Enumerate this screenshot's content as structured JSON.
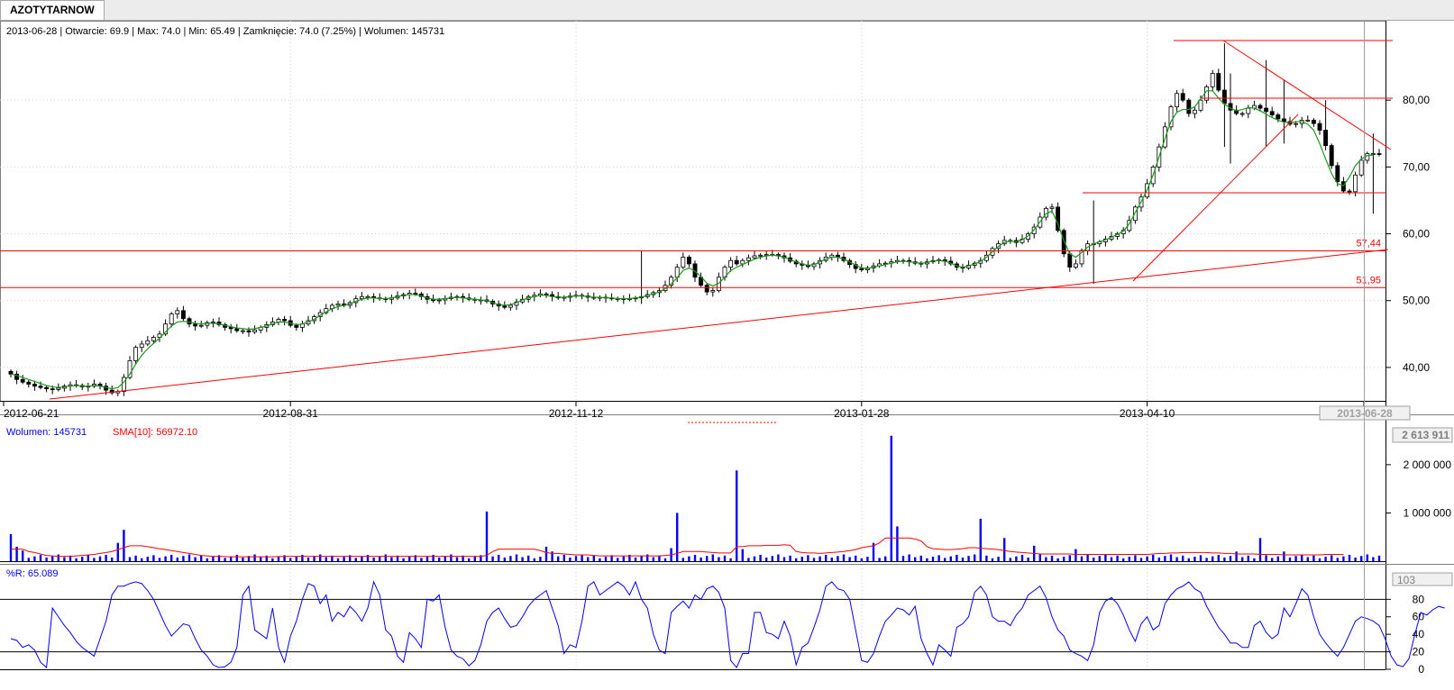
{
  "tab": {
    "title": "AZOTYTARNOW"
  },
  "price_info": "2013-06-28 | Otwarcie: 69.9 | Max: 74.0 | Min: 65.49 | Zamknięcie: 74.0 (7.25%)  | Wolumen: 145731",
  "volume_info": {
    "label": "Wolumen: 145731",
    "sma_label": "SMA[10]: 56972.10"
  },
  "wr_info": "%R: 65.089",
  "colors": {
    "up": "#ffffff",
    "down": "#000000",
    "sma": "#1a9a1a",
    "lines": "#ff0000",
    "volume": "#0000ff",
    "wr": "#0000ff"
  },
  "chart_data": [
    {
      "type": "candlestick",
      "x_labels": [
        "2012-06-21",
        "2012-08-31",
        "2012-11-12",
        "2013-01-28",
        "2013-04-10",
        "2013-06-28"
      ],
      "y_ticks": [
        "40,00",
        "50,00",
        "60,00",
        "70,00",
        "80,00"
      ],
      "ylim": [
        35,
        90
      ],
      "h_levels": [
        {
          "value": 57.44,
          "label": "57,44"
        },
        {
          "value": 51.95,
          "label": "51,95"
        }
      ],
      "close": [
        39,
        38.2,
        37.8,
        37.5,
        37.2,
        37,
        36.8,
        36.7,
        36.9,
        37.2,
        37.4,
        37.3,
        37.1,
        37.2,
        37.5,
        37.2,
        36.6,
        36.2,
        36.4,
        38.5,
        41,
        43,
        43.5,
        44,
        44.5,
        45,
        46.5,
        48,
        48.5,
        47.3,
        46.5,
        46.2,
        46.3,
        46.7,
        46.8,
        46.4,
        46,
        45.8,
        45.5,
        45.5,
        45.3,
        45.6,
        46,
        46.4,
        46.8,
        47.2,
        47,
        46.3,
        46,
        46.5,
        47,
        47.6,
        48.2,
        48.8,
        49.3,
        49.5,
        49.3,
        49.7,
        50.3,
        50.6,
        50.6,
        50.4,
        50.3,
        50.2,
        50.4,
        50.7,
        50.9,
        51.1,
        51,
        50.6,
        50.2,
        50,
        50.1,
        50.3,
        50.5,
        50.6,
        50.4,
        50.2,
        50.1,
        50.1,
        49.9,
        49.5,
        49.2,
        49,
        49.3,
        49.8,
        50.2,
        50.6,
        50.8,
        51,
        50.9,
        50.6,
        50.4,
        50.5,
        50.7,
        50.8,
        50.7,
        50.5,
        50.4,
        50.5,
        50.4,
        50.3,
        50.3,
        50.2,
        50.3,
        50.4,
        50.6,
        50.9,
        51.2,
        51.5,
        52.3,
        53.5,
        55,
        56.5,
        55.5,
        53.5,
        52.3,
        51.3,
        51.5,
        53.5,
        55,
        56,
        55.5,
        56,
        56.4,
        56.7,
        56.8,
        56.9,
        56.9,
        56.7,
        56.4,
        55.9,
        55.5,
        55.3,
        55.1,
        55.5,
        56,
        56.5,
        56.8,
        56.5,
        56,
        55.4,
        54.8,
        54.6,
        54.9,
        55.2,
        55.5,
        55.6,
        55.8,
        56,
        56,
        55.8,
        55.6,
        55.5,
        55.8,
        56,
        56.1,
        55.9,
        55.5,
        55,
        54.9,
        55.3,
        55.6,
        56,
        56.8,
        57.8,
        58.5,
        59,
        59,
        58.7,
        59.2,
        60,
        61,
        62.5,
        63.8,
        64,
        60.5,
        57,
        55,
        55.5,
        57.5,
        58.5,
        58.5,
        58.8,
        59.2,
        59.6,
        60,
        60.5,
        62,
        64,
        65.5,
        67.5,
        70,
        73,
        76,
        79,
        81,
        80,
        78,
        78.5,
        80,
        82,
        84,
        81.5,
        79.5,
        78.5,
        78,
        78,
        78.8,
        79.2,
        78.8,
        78.3,
        77.8,
        77.2,
        76.8,
        76.4,
        76.5,
        77,
        77,
        76.5,
        75.5,
        73.2,
        70.2,
        67.8,
        66.4,
        66.3,
        68.8,
        71,
        72,
        72,
        71.9
      ],
      "sma": [
        39,
        38.8,
        38.5,
        38.2,
        37.9,
        37.6,
        37.3,
        37.1,
        37,
        37.1,
        37.2,
        37.3,
        37.2,
        37.2,
        37.3,
        37.2,
        37,
        36.8,
        37,
        37.8,
        39,
        40.5,
        41.8,
        42.8,
        43.6,
        44.4,
        45.3,
        46.2,
        46.8,
        46.9,
        46.8,
        46.6,
        46.5,
        46.6,
        46.6,
        46.5,
        46.3,
        46.1,
        45.9,
        45.8,
        45.7,
        45.8,
        46,
        46.2,
        46.5,
        46.8,
        46.8,
        46.6,
        46.4,
        46.5,
        46.8,
        47.2,
        47.8,
        48.3,
        48.8,
        49.1,
        49.3,
        49.5,
        49.9,
        50.2,
        50.4,
        50.4,
        50.3,
        50.3,
        50.4,
        50.6,
        50.8,
        50.9,
        50.9,
        50.7,
        50.4,
        50.2,
        50.2,
        50.3,
        50.4,
        50.5,
        50.4,
        50.3,
        50.2,
        50.1,
        50,
        49.7,
        49.4,
        49.3,
        49.4,
        49.7,
        50.1,
        50.4,
        50.6,
        50.8,
        50.8,
        50.6,
        50.5,
        50.5,
        50.6,
        50.7,
        50.7,
        50.6,
        50.5,
        50.5,
        50.4,
        50.4,
        50.3,
        50.3,
        50.3,
        50.4,
        50.5,
        50.8,
        51,
        51.3,
        51.8,
        52.5,
        53.4,
        54.5,
        54.9,
        54.4,
        53.6,
        52.6,
        52.2,
        52.6,
        53.5,
        54.5,
        55,
        55.4,
        55.8,
        56.2,
        56.5,
        56.7,
        56.8,
        56.7,
        56.5,
        56.1,
        55.8,
        55.5,
        55.3,
        55.4,
        55.8,
        56.2,
        56.5,
        56.5,
        56.2,
        55.8,
        55.3,
        54.9,
        54.8,
        55,
        55.2,
        55.4,
        55.6,
        55.8,
        55.9,
        55.8,
        55.7,
        55.6,
        55.7,
        55.9,
        56,
        55.9,
        55.6,
        55.2,
        55,
        55.2,
        55.5,
        55.9,
        56.5,
        57.3,
        58.1,
        58.7,
        58.9,
        58.8,
        59.1,
        59.7,
        60.6,
        61.8,
        63,
        63.4,
        61.5,
        59,
        57,
        56.5,
        57.2,
        58,
        58.5,
        58.8,
        59.1,
        59.5,
        59.9,
        60.4,
        61.5,
        63.2,
        64.8,
        66.6,
        68.8,
        71.5,
        74.3,
        76.8,
        78.2,
        78.6,
        78.6,
        79,
        80.2,
        81.4,
        81.4,
        80.3,
        79.4,
        78.8,
        78.4,
        78.6,
        78.9,
        78.8,
        78.4,
        77.9,
        77.4,
        77,
        76.7,
        76.6,
        76.8,
        76.8,
        76.4,
        75.5,
        73.5,
        71.2,
        69,
        67.5,
        67.2,
        68.5,
        70.2,
        71.2,
        71.7,
        71.8
      ],
      "candle_spikes": [
        {
          "i": 204,
          "high": 88.5,
          "low": 73
        },
        {
          "i": 205,
          "high": 84,
          "low": 70.5
        },
        {
          "i": 211,
          "high": 86,
          "low": 73
        },
        {
          "i": 221,
          "high": 80,
          "low": 72.5
        },
        {
          "i": 229,
          "high": 75,
          "low": 63
        },
        {
          "i": 214,
          "high": 83,
          "low": 73.5
        },
        {
          "i": 182,
          "high": 65,
          "low": 52.5
        },
        {
          "i": 106,
          "high": 57.5,
          "low": 49.5
        }
      ]
    },
    {
      "type": "bar",
      "y_ticks": [
        "1 000 000",
        "2 000 000"
      ],
      "ylim": [
        0,
        2800000
      ],
      "last_label": "2 613 911",
      "spikes": [
        {
          "i": 0,
          "value": 560000
        },
        {
          "i": 1,
          "value": 300000
        },
        {
          "i": 2,
          "value": 220000
        },
        {
          "i": 18,
          "value": 380000
        },
        {
          "i": 19,
          "value": 650000
        },
        {
          "i": 80,
          "value": 1030000
        },
        {
          "i": 90,
          "value": 300000
        },
        {
          "i": 91,
          "value": 200000
        },
        {
          "i": 111,
          "value": 270000
        },
        {
          "i": 112,
          "value": 1000000
        },
        {
          "i": 122,
          "value": 1880000
        },
        {
          "i": 123,
          "value": 250000
        },
        {
          "i": 145,
          "value": 380000
        },
        {
          "i": 148,
          "value": 2600000
        },
        {
          "i": 149,
          "value": 720000
        },
        {
          "i": 163,
          "value": 880000
        },
        {
          "i": 167,
          "value": 480000
        },
        {
          "i": 172,
          "value": 320000
        },
        {
          "i": 179,
          "value": 250000
        },
        {
          "i": 210,
          "value": 480000
        },
        {
          "i": 214,
          "value": 200000
        },
        {
          "i": 206,
          "value": 200000
        }
      ],
      "base": 60000,
      "sma_values": [
        250000,
        250000,
        250000,
        200000,
        180000,
        150000,
        120000,
        110000,
        100000,
        100000,
        100000,
        110000,
        120000,
        130000,
        140000,
        160000,
        180000,
        200000,
        240000,
        280000,
        320000,
        320000,
        320000,
        300000,
        280000,
        260000,
        240000,
        220000,
        200000,
        180000,
        160000,
        140000,
        120000,
        110000,
        100000,
        100000,
        95000,
        90000,
        90000,
        90000,
        90000,
        90000,
        90000,
        90000,
        90000,
        95000,
        100000,
        100000,
        100000,
        100000,
        100000,
        100000,
        100000,
        100000,
        100000,
        100000,
        100000,
        100000,
        100000,
        100000,
        100000,
        100000,
        100000,
        100000,
        100000,
        100000,
        100000,
        100000,
        100000,
        100000,
        100000,
        100000,
        100000,
        100000,
        100000,
        100000,
        100000,
        100000,
        100000,
        100000,
        120000,
        200000,
        250000,
        250000,
        250000,
        250000,
        250000,
        250000,
        250000,
        220000,
        180000,
        160000,
        160000,
        150000,
        140000,
        130000,
        130000,
        130000,
        120000,
        110000,
        110000,
        110000,
        110000,
        110000,
        110000,
        110000,
        110000,
        110000,
        110000,
        110000,
        120000,
        130000,
        160000,
        200000,
        200000,
        200000,
        200000,
        190000,
        180000,
        170000,
        170000,
        170000,
        300000,
        300000,
        320000,
        320000,
        320000,
        330000,
        330000,
        330000,
        340000,
        330000,
        200000,
        180000,
        170000,
        170000,
        160000,
        170000,
        180000,
        190000,
        200000,
        220000,
        240000,
        280000,
        300000,
        320000,
        380000,
        480000,
        480000,
        480000,
        480000,
        480000,
        460000,
        420000,
        300000,
        260000,
        250000,
        240000,
        240000,
        250000,
        260000,
        280000,
        280000,
        270000,
        260000,
        250000,
        240000,
        220000,
        200000,
        190000,
        180000,
        170000,
        160000,
        150000,
        150000,
        150000,
        150000,
        150000,
        150000,
        140000,
        140000,
        140000,
        140000,
        140000,
        140000,
        140000,
        140000,
        140000,
        140000,
        140000,
        140000,
        140000,
        150000,
        160000,
        160000,
        170000,
        170000,
        180000,
        180000,
        180000,
        180000,
        180000,
        170000,
        170000,
        160000,
        160000,
        150000,
        150000,
        150000,
        150000,
        140000,
        140000,
        140000,
        140000,
        130000,
        130000,
        130000,
        130000,
        130000,
        130000,
        130000,
        140000,
        140000,
        140000,
        140000
      ]
    },
    {
      "type": "line",
      "y_ticks": [
        "0",
        "20",
        "40",
        "60",
        "80"
      ],
      "ylim": [
        0,
        103
      ],
      "top_label": "103",
      "values": [
        35,
        33,
        25,
        28,
        22,
        8,
        2,
        70,
        60,
        50,
        42,
        32,
        25,
        20,
        15,
        35,
        55,
        85,
        95,
        95,
        98,
        100,
        98,
        90,
        80,
        65,
        50,
        38,
        45,
        52,
        50,
        35,
        22,
        15,
        5,
        2,
        3,
        8,
        25,
        85,
        95,
        45,
        40,
        35,
        70,
        25,
        8,
        38,
        55,
        80,
        98,
        95,
        75,
        85,
        55,
        65,
        60,
        72,
        65,
        55,
        70,
        100,
        85,
        45,
        38,
        15,
        8,
        42,
        35,
        25,
        80,
        78,
        85,
        48,
        22,
        15,
        12,
        4,
        10,
        28,
        55,
        65,
        70,
        58,
        48,
        50,
        60,
        72,
        80,
        85,
        90,
        70,
        50,
        18,
        28,
        25,
        55,
        95,
        100,
        85,
        90,
        95,
        100,
        95,
        85,
        100,
        80,
        70,
        40,
        22,
        18,
        65,
        72,
        78,
        70,
        85,
        80,
        92,
        95,
        88,
        70,
        10,
        2,
        18,
        18,
        65,
        65,
        42,
        40,
        35,
        55,
        38,
        5,
        25,
        30,
        48,
        68,
        95,
        100,
        92,
        90,
        80,
        45,
        10,
        8,
        18,
        38,
        55,
        62,
        70,
        68,
        62,
        72,
        35,
        18,
        5,
        28,
        22,
        15,
        48,
        52,
        60,
        88,
        95,
        85,
        60,
        55,
        55,
        50,
        62,
        70,
        85,
        90,
        95,
        82,
        60,
        45,
        38,
        22,
        18,
        15,
        10,
        28,
        65,
        78,
        82,
        75,
        62,
        45,
        32,
        52,
        60,
        45,
        50,
        75,
        85,
        92,
        95,
        100,
        92,
        88,
        72,
        60,
        48,
        40,
        30,
        30,
        25,
        25,
        50,
        55,
        42,
        35,
        40,
        70,
        60,
        75,
        92,
        85,
        60,
        40,
        30,
        22,
        15,
        25,
        40,
        55,
        60,
        58,
        55,
        50,
        35,
        15,
        5,
        3,
        12,
        40,
        65,
        62,
        68,
        72,
        70
      ]
    }
  ]
}
